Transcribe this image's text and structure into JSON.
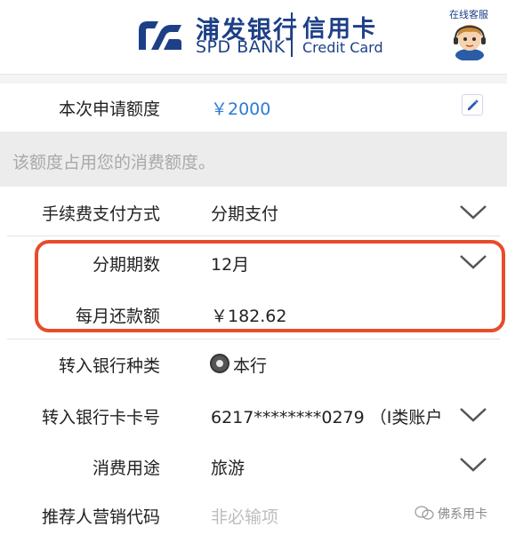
{
  "header": {
    "bank_name_cn": "浦发银行",
    "bank_name_en": "SPD BANK",
    "card_cn": "信用卡",
    "card_en": "Credit Card",
    "customer_service": "在线客服"
  },
  "amount": {
    "label": "本次申请额度",
    "value": "￥2000"
  },
  "note": "该额度占用您的消费额度。",
  "form": {
    "fee": {
      "label": "手续费支付方式",
      "value": "分期支付"
    },
    "period": {
      "label": "分期期数",
      "value": "12月"
    },
    "monthly": {
      "label": "每月还款额",
      "value": "￥182.62"
    },
    "bank": {
      "label": "转入银行种类",
      "value": "本行"
    },
    "card": {
      "label": "转入银行卡卡号",
      "value": "6217********0279 （Ⅰ类账户"
    },
    "purpose": {
      "label": "消费用途",
      "value": "旅游"
    },
    "referrer": {
      "label": "推荐人营销代码",
      "placeholder": "非必输项"
    }
  },
  "watermark": "佛系用卡",
  "colors": {
    "brand": "#1c3f86",
    "accent": "#2c7bd6",
    "highlight": "#e94b2b"
  }
}
